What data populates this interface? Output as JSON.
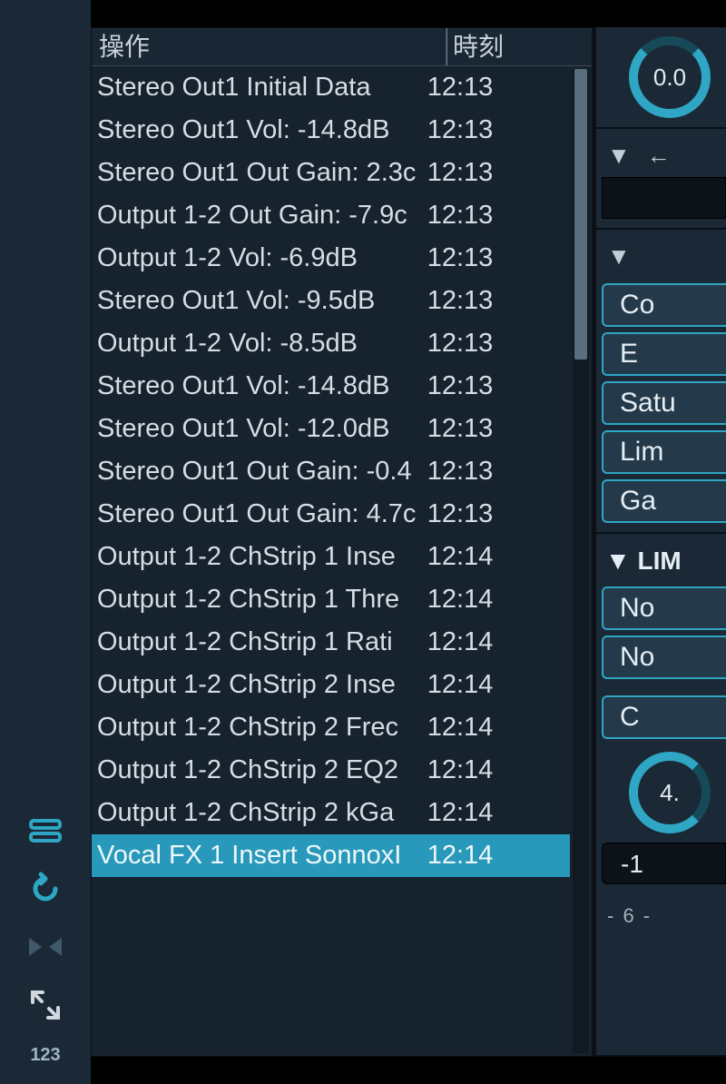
{
  "header": {
    "operation_label": "操作",
    "time_label": "時刻"
  },
  "history": [
    {
      "op": "Stereo Out1 Initial Data",
      "time": "12:13",
      "selected": false
    },
    {
      "op": "Stereo Out1 Vol: -14.8dB",
      "time": "12:13",
      "selected": false
    },
    {
      "op": "Stereo Out1 Out Gain: 2.3c",
      "time": "12:13",
      "selected": false
    },
    {
      "op": "Output 1-2 Out Gain: -7.9c",
      "time": "12:13",
      "selected": false
    },
    {
      "op": "Output 1-2 Vol: -6.9dB",
      "time": "12:13",
      "selected": false
    },
    {
      "op": "Stereo Out1 Vol: -9.5dB",
      "time": "12:13",
      "selected": false
    },
    {
      "op": "Output 1-2 Vol: -8.5dB",
      "time": "12:13",
      "selected": false
    },
    {
      "op": "Stereo Out1 Vol: -14.8dB",
      "time": "12:13",
      "selected": false
    },
    {
      "op": "Stereo Out1 Vol: -12.0dB",
      "time": "12:13",
      "selected": false
    },
    {
      "op": "Stereo Out1 Out Gain: -0.4",
      "time": "12:13",
      "selected": false
    },
    {
      "op": "Stereo Out1 Out Gain: 4.7c",
      "time": "12:13",
      "selected": false
    },
    {
      "op": "Output 1-2 ChStrip 1 Inse",
      "time": "12:14",
      "selected": false
    },
    {
      "op": "Output 1-2 ChStrip 1 Thre",
      "time": "12:14",
      "selected": false
    },
    {
      "op": "Output 1-2 ChStrip 1 Rati",
      "time": "12:14",
      "selected": false
    },
    {
      "op": "Output 1-2 ChStrip 2 Inse",
      "time": "12:14",
      "selected": false
    },
    {
      "op": "Output 1-2 ChStrip 2 Frec",
      "time": "12:14",
      "selected": false
    },
    {
      "op": "Output 1-2 ChStrip 2 EQ2",
      "time": "12:14",
      "selected": false
    },
    {
      "op": "Output 1-2 ChStrip 2 kGa",
      "time": "12:14",
      "selected": false
    },
    {
      "op": "Vocal FX 1 Insert SonnoxI",
      "time": "12:14",
      "selected": true
    }
  ],
  "toolbar": {
    "counter_label": "123"
  },
  "right": {
    "knob_top_value": "0.0",
    "modules": [
      "Co",
      "E",
      "Satu",
      "Lim",
      "Ga"
    ],
    "section_label": "▼ LIM",
    "option1": "No",
    "option2": "No",
    "ceiling_btn": "C",
    "knob_bottom_value": "4.",
    "gain_value": "-1",
    "tick_label": "- 6   -"
  }
}
